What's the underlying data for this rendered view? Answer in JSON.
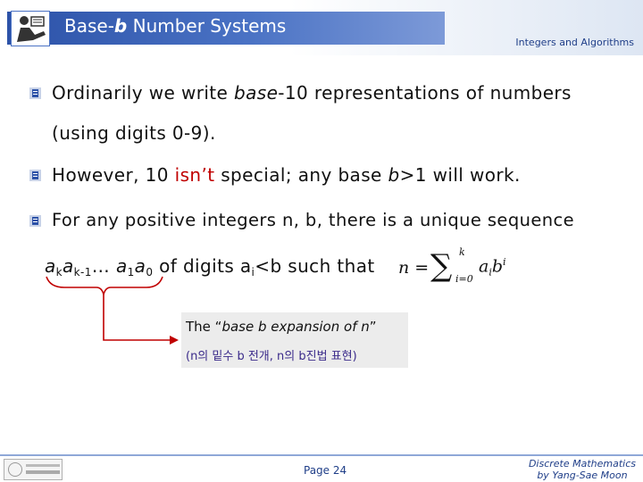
{
  "header": {
    "title_prefix": "Base-",
    "title_var": "b",
    "title_suffix": " Number Systems",
    "topic": "Integers and Algorithms"
  },
  "bullets": [
    {
      "line1_a": "Ordinarily we write ",
      "line1_em": "base",
      "line1_b": "-10 representations of numbers",
      "line2": "(using digits 0-9)."
    },
    {
      "a": "However, 10 ",
      "emph": "isn’t",
      "b": " special; any base ",
      "var": "b",
      "c": ">1 will work."
    },
    {
      "line1": "For any positive integers n, b, there is a unique sequence",
      "seq_a": "a",
      "seq_k": "k",
      "seq_a2": "a",
      "seq_k1": "k-1",
      "seq_dots": "… ",
      "seq_a3": "a",
      "seq_1": "1",
      "seq_a4": "a",
      "seq_0": "0",
      "mid": " of digits a",
      "mid_i": "i",
      "tail": "<b such that"
    }
  ],
  "formula": {
    "lhs": "n =",
    "sigma": "∑",
    "upper": "k",
    "lower": "i=0",
    "term_a": "a",
    "term_i": "i",
    "term_b": "b",
    "term_exp": "i"
  },
  "callout": {
    "line1_a": "The “",
    "line1_em": "base b expansion of n",
    "line1_b": "”",
    "line2": "(n의 밑수 b 전개, n의 b진법 표현)"
  },
  "footer": {
    "page": "Page 24",
    "course_line1": "Discrete Mathematics",
    "course_line2": "by Yang-Sae Moon"
  },
  "colors": {
    "header_bar": "#2c52a8",
    "accent_text": "#1f3e88",
    "emphasis_red": "#c00000",
    "bracket": "#c00000"
  }
}
